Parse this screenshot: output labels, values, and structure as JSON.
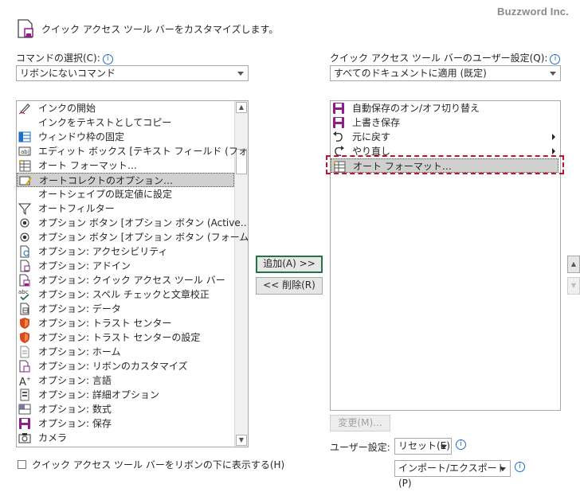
{
  "watermark": "Buzzword Inc.",
  "heading": "クイック アクセス ツール バーをカスタマイズします。",
  "left": {
    "command_label": "コマンドの選択(C):",
    "command_select": "リボンにないコマンド",
    "items": [
      {
        "label": "インクの開始",
        "icon": "ink-pen-icon"
      },
      {
        "label": "インクをテキストとしてコピー",
        "icon": "none"
      },
      {
        "label": "ウィンドウ枠の固定",
        "icon": "freeze-panes-icon"
      },
      {
        "label": "エディット ボックス [テキスト フィールド (フォー…",
        "icon": "edit-box-icon"
      },
      {
        "label": "オート フォーマット…",
        "icon": "autoformat-icon"
      },
      {
        "label": "オートコレクトのオプション…",
        "icon": "autocorrect-icon",
        "selected": true
      },
      {
        "label": "オートシェイプの既定値に設定",
        "icon": "none"
      },
      {
        "label": "オートフィルター",
        "icon": "filter-icon"
      },
      {
        "label": "オプション ボタン [オプション ボタン (Active…",
        "icon": "radio-button-icon"
      },
      {
        "label": "オプション ボタン [オプション ボタン (フォーム …",
        "icon": "radio-button-icon"
      },
      {
        "label": "オプション: アクセシビリティ",
        "icon": "accessibility-icon"
      },
      {
        "label": "オプション: アドイン",
        "icon": "addin-icon"
      },
      {
        "label": "オプション: クイック アクセス ツール バー",
        "icon": "qat-icon"
      },
      {
        "label": "オプション: スペル チェックと文章校正",
        "icon": "spelling-icon"
      },
      {
        "label": "オプション: データ",
        "icon": "data-icon"
      },
      {
        "label": "オプション: トラスト センター",
        "icon": "shield-icon"
      },
      {
        "label": "オプション: トラスト センターの設定",
        "icon": "shield-icon"
      },
      {
        "label": "オプション: ホーム",
        "icon": "home-options-icon"
      },
      {
        "label": "オプション: リボンのカスタマイズ",
        "icon": "ribbon-icon"
      },
      {
        "label": "オプション: 言語",
        "icon": "language-icon"
      },
      {
        "label": "オプション: 詳細オプション",
        "icon": "advanced-icon"
      },
      {
        "label": "オプション: 数式",
        "icon": "formula-icon"
      },
      {
        "label": "オプション: 保存",
        "icon": "save-icon"
      },
      {
        "label": "カメラ",
        "icon": "camera-icon"
      }
    ],
    "show_below_label": "クイック アクセス ツール バーをリボンの下に表示する(H)"
  },
  "buttons": {
    "add": "追加(A) >>",
    "remove": "<< 削除(R)"
  },
  "right": {
    "settings_label": "クイック アクセス ツール バーのユーザー設定(Q):",
    "settings_select": "すべてのドキュメントに適用 (既定)",
    "items": [
      {
        "label": "自動保存のオン/オフ切り替え",
        "icon": "save-icon"
      },
      {
        "label": "上書き保存",
        "icon": "save-icon"
      },
      {
        "label": "元に戻す",
        "icon": "undo-icon",
        "submenu": true
      },
      {
        "label": "やり直し",
        "icon": "redo-icon",
        "submenu": true
      },
      {
        "label": "オート フォーマット…",
        "icon": "autoformat-icon",
        "selected": true
      }
    ],
    "modify": "変更(M)...",
    "user_settings_label": "ユーザー設定:",
    "reset": "リセット(E)",
    "import_export": "インポート/エクスポート(P)"
  },
  "colors": {
    "accent_green": "#227447",
    "highlight_red": "#c8102e",
    "save_purple": "#8b1e8b",
    "info_blue": "#1e6ec8"
  }
}
